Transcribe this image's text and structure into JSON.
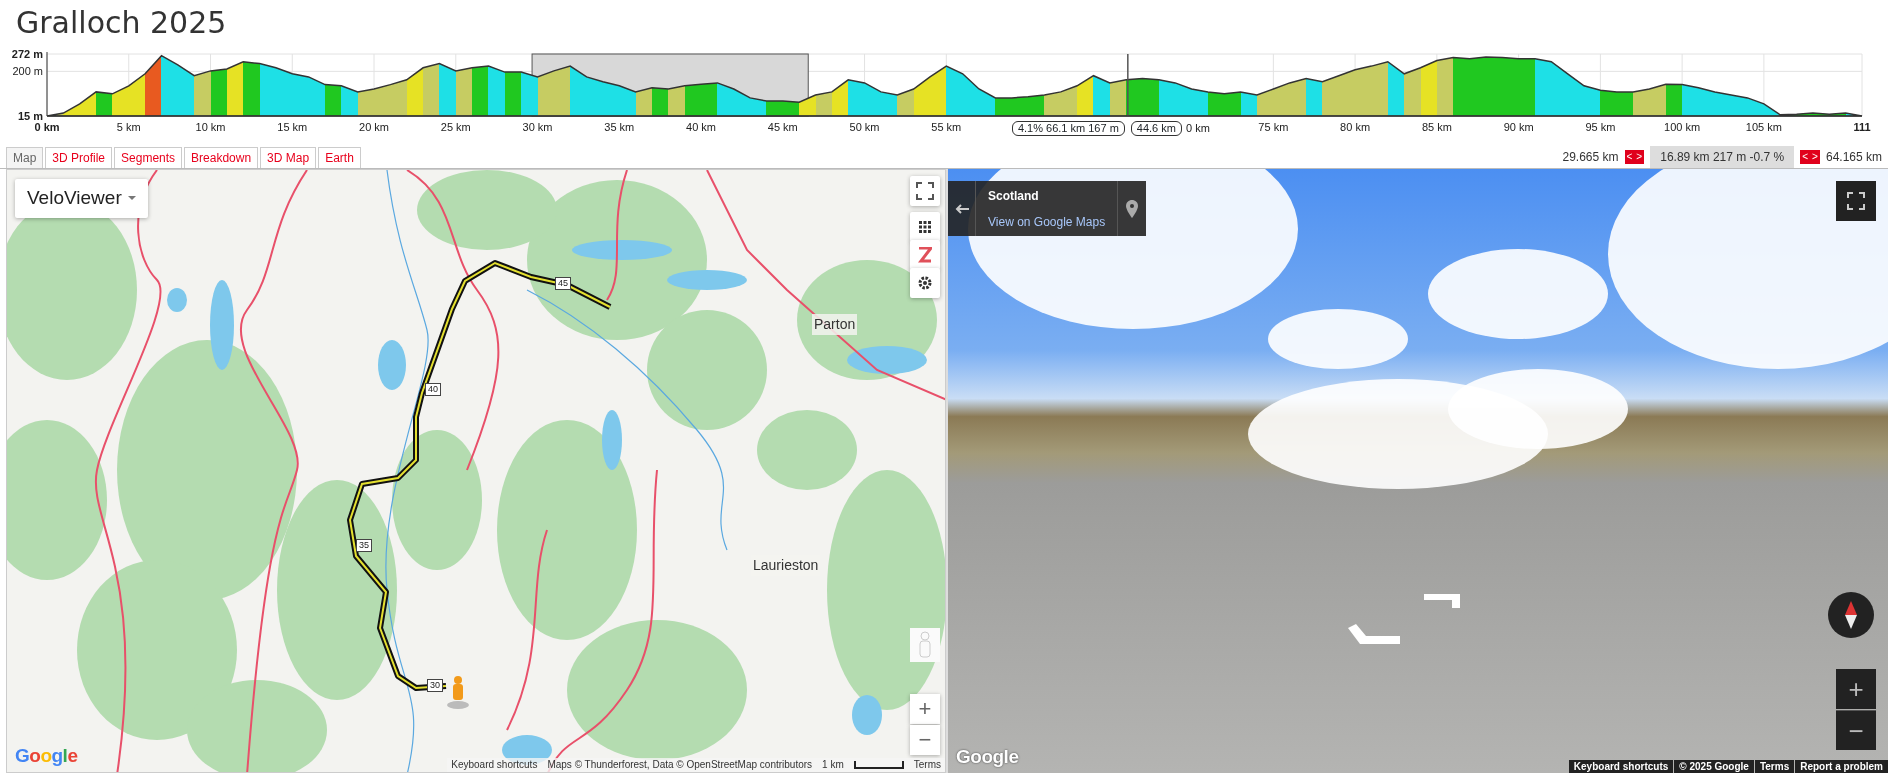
{
  "title": "Gralloch 2025",
  "profile": {
    "chart_data": {
      "type": "area",
      "x": [
        0,
        1,
        2,
        3,
        4,
        5,
        6,
        7,
        8,
        9,
        10,
        11,
        12,
        13,
        14,
        15,
        16,
        17,
        18,
        19,
        20,
        21,
        22,
        23,
        24,
        25,
        26,
        27,
        28,
        29,
        30,
        31,
        32,
        33,
        34,
        35,
        36,
        37,
        38,
        39,
        40,
        41,
        42,
        43,
        44,
        45,
        46,
        47,
        48,
        49,
        50,
        51,
        52,
        53,
        54,
        55,
        56,
        57,
        58,
        59,
        60,
        61,
        62,
        63,
        64,
        65,
        66,
        67,
        68,
        69,
        70,
        71,
        72,
        73,
        74,
        75,
        76,
        77,
        78,
        79,
        80,
        81,
        82,
        83,
        84,
        85,
        86,
        87,
        88,
        89,
        90,
        91,
        92,
        93,
        94,
        95,
        96,
        97,
        98,
        99,
        100,
        101,
        102,
        103,
        104,
        105,
        106,
        107,
        108,
        109,
        110,
        111
      ],
      "series": [
        {
          "color": "#333333",
          "values": [
            15,
            27,
            65,
            115,
            107,
            140,
            190,
            265,
            227,
            182,
            202,
            210,
            240,
            232,
            215,
            190,
            177,
            145,
            140,
            115,
            127,
            145,
            165,
            215,
            232,
            202,
            215,
            222,
            197,
            197,
            177,
            202,
            222,
            177,
            157,
            140,
            115,
            132,
            127,
            140,
            147,
            152,
            127,
            90,
            77,
            77,
            72,
            102,
            115,
            165,
            152,
            115,
            102,
            127,
            177,
            222,
            190,
            127,
            90,
            90,
            95,
            102,
            115,
            140,
            182,
            152,
            165,
            170,
            165,
            152,
            127,
            115,
            107,
            115,
            102,
            127,
            152,
            170,
            157,
            182,
            207,
            222,
            240,
            190,
            215,
            245,
            257,
            252,
            260,
            257,
            252,
            252,
            240,
            190,
            140,
            122,
            115,
            115,
            127,
            147,
            145,
            132,
            115,
            102,
            90,
            65,
            20,
            22,
            27,
            22,
            27,
            15
          ]
        }
      ],
      "xlim": [
        0,
        111
      ],
      "ylim": [
        15,
        272
      ],
      "xticks": [
        {
          "value": 0,
          "label": "0 km"
        },
        {
          "value": 5,
          "label": "5 km"
        },
        {
          "value": 10,
          "label": "10 km"
        },
        {
          "value": 15,
          "label": "15 km"
        },
        {
          "value": 20,
          "label": "20 km"
        },
        {
          "value": 25,
          "label": "25 km"
        },
        {
          "value": 30,
          "label": "30 km"
        },
        {
          "value": 35,
          "label": "35 km"
        },
        {
          "value": 40,
          "label": "40 km"
        },
        {
          "value": 45,
          "label": "45 km"
        },
        {
          "value": 50,
          "label": "50 km"
        },
        {
          "value": 55,
          "label": "55 km"
        },
        {
          "value": 75,
          "label": "75 km"
        },
        {
          "value": 80,
          "label": "80 km"
        },
        {
          "value": 85,
          "label": "85 km"
        },
        {
          "value": 90,
          "label": "90 km"
        },
        {
          "value": 95,
          "label": "95 km"
        },
        {
          "value": 100,
          "label": "100 km"
        },
        {
          "value": 105,
          "label": "105 km"
        },
        {
          "value": 111,
          "label": "111"
        }
      ],
      "yticks": [
        {
          "value": 15,
          "label": "15 m"
        },
        {
          "value": 200,
          "label": "200 m"
        },
        {
          "value": 272,
          "label": "272 m"
        }
      ],
      "grid": true,
      "bands": [
        {
          "axis": "x",
          "from": 29.665,
          "to": 46.555
        }
      ],
      "ref_lines": [
        {
          "axis": "x",
          "value": 66.1
        }
      ],
      "annotations": [
        "4.1% 66.1 km 167 m"
      ]
    },
    "hover_labels": [
      "44.6 km"
    ],
    "partial_tick_label": "0 km"
  },
  "tabs": [
    {
      "label": "Map",
      "selected": true
    },
    {
      "label": "3D Profile",
      "selected": false
    },
    {
      "label": "Segments",
      "selected": false
    },
    {
      "label": "Breakdown",
      "selected": false
    },
    {
      "label": "3D Map",
      "selected": false
    },
    {
      "label": "Earth",
      "selected": false
    }
  ],
  "selection_bar": {
    "start": "29.665 km",
    "start_prev": "<",
    "start_next": ">",
    "summary": "16.89 km 217 m -0.7 %",
    "end_prev": "<",
    "end_next": ">",
    "end": "64.165 km"
  },
  "map": {
    "layer_menu": "VeloViewer",
    "route_markers": [
      "45",
      "40",
      "35",
      "30"
    ],
    "place_labels": [
      "Parton",
      "Laurieston"
    ],
    "zoom_in": "+",
    "zoom_out": "−",
    "logo": "Google",
    "attribution": [
      "Keyboard shortcuts",
      "Maps © Thunderforest, Data © OpenStreetMap contributors"
    ],
    "scale": "1 km",
    "terms": "Terms"
  },
  "street_view": {
    "location": "Scotland",
    "link": "View on Google Maps",
    "zoom_in": "+",
    "zoom_out": "−",
    "logo": "Google",
    "footer": [
      "Keyboard shortcuts",
      "© 2025 Google",
      "Terms",
      "Report a problem"
    ]
  }
}
